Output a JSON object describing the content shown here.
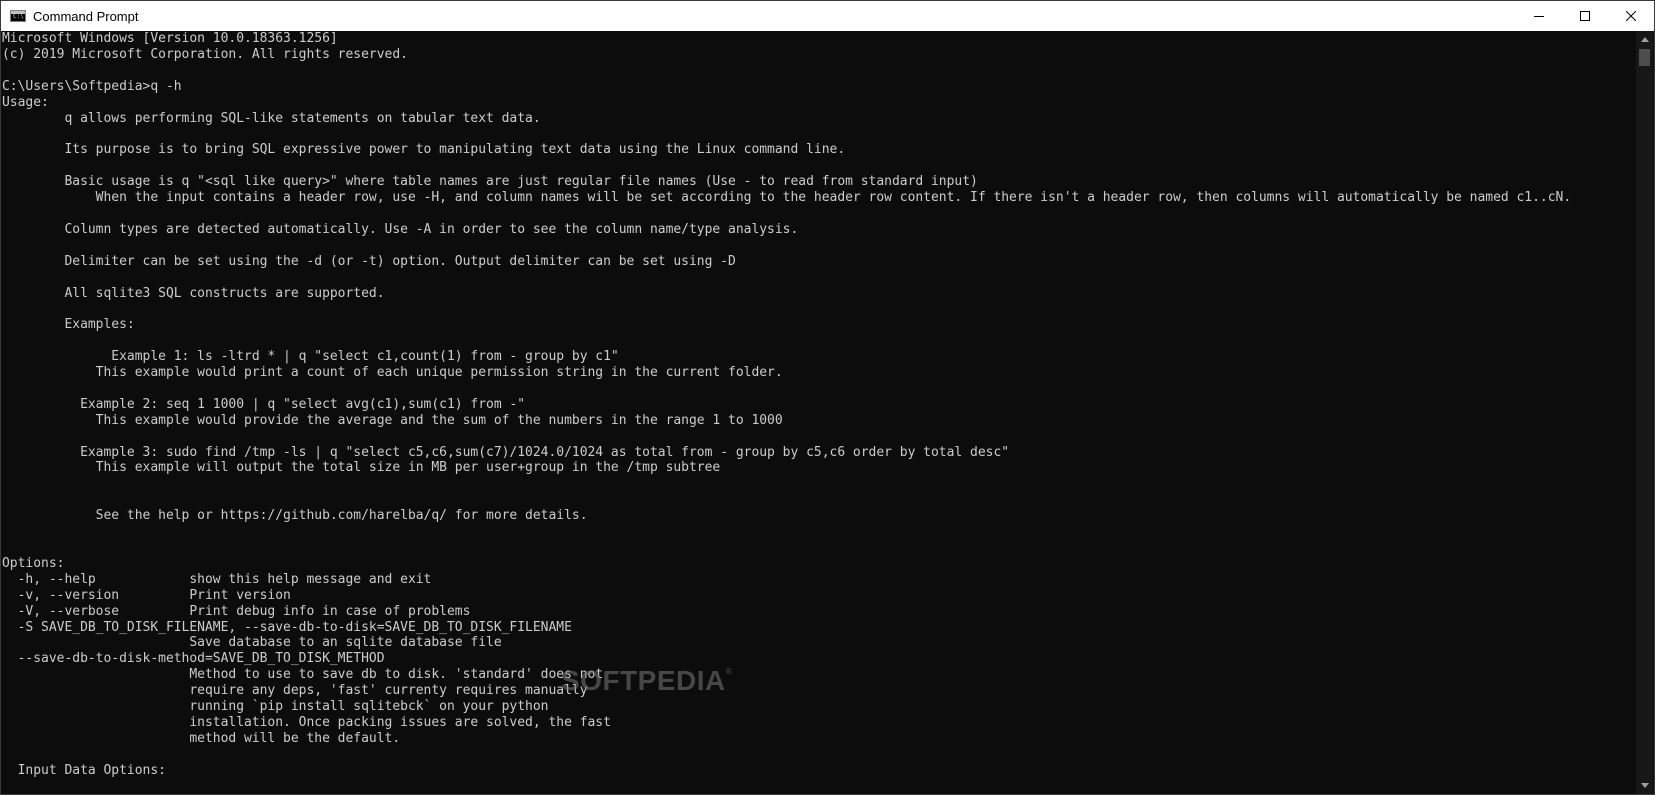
{
  "window": {
    "title": "Command Prompt",
    "icon": "console-app-icon",
    "icon_glyph": "C:\\",
    "minimize_icon": "minimize-icon",
    "maximize_icon": "maximize-icon",
    "close_icon": "close-icon"
  },
  "console": {
    "lines": [
      "Microsoft Windows [Version 10.0.18363.1256]",
      "(c) 2019 Microsoft Corporation. All rights reserved.",
      "",
      "C:\\Users\\Softpedia>q -h",
      "Usage:",
      "        q allows performing SQL-like statements on tabular text data.",
      "",
      "        Its purpose is to bring SQL expressive power to manipulating text data using the Linux command line.",
      "",
      "        Basic usage is q \"<sql like query>\" where table names are just regular file names (Use - to read from standard input)",
      "            When the input contains a header row, use -H, and column names will be set according to the header row content. If there isn't a header row, then columns will automatically be named c1..cN.",
      "",
      "        Column types are detected automatically. Use -A in order to see the column name/type analysis.",
      "",
      "        Delimiter can be set using the -d (or -t) option. Output delimiter can be set using -D",
      "",
      "        All sqlite3 SQL constructs are supported.",
      "",
      "        Examples:",
      "",
      "              Example 1: ls -ltrd * | q \"select c1,count(1) from - group by c1\"",
      "            This example would print a count of each unique permission string in the current folder.",
      "",
      "          Example 2: seq 1 1000 | q \"select avg(c1),sum(c1) from -\"",
      "            This example would provide the average and the sum of the numbers in the range 1 to 1000",
      "",
      "          Example 3: sudo find /tmp -ls | q \"select c5,c6,sum(c7)/1024.0/1024 as total from - group by c5,c6 order by total desc\"",
      "            This example will output the total size in MB per user+group in the /tmp subtree",
      "",
      "",
      "            See the help or https://github.com/harelba/q/ for more details.",
      "",
      "",
      "Options:",
      "  -h, --help            show this help message and exit",
      "  -v, --version         Print version",
      "  -V, --verbose         Print debug info in case of problems",
      "  -S SAVE_DB_TO_DISK_FILENAME, --save-db-to-disk=SAVE_DB_TO_DISK_FILENAME",
      "                        Save database to an sqlite database file",
      "  --save-db-to-disk-method=SAVE_DB_TO_DISK_METHOD",
      "                        Method to use to save db to disk. 'standard' does not",
      "                        require any deps, 'fast' currenty requires manually",
      "                        running `pip install sqlitebck` on your python",
      "                        installation. Once packing issues are solved, the fast",
      "                        method will be the default.",
      "",
      "  Input Data Options:"
    ]
  },
  "watermark": {
    "text": "SOFTPEDIA",
    "mark": "®"
  },
  "colors": {
    "background": "#0c0c0c",
    "text": "#cccccc",
    "titlebar": "#ffffff",
    "scrollbar_track": "#171717",
    "scrollbar_thumb": "#4d4d4d"
  },
  "scrollbar": {
    "up_icon": "scroll-up-arrow-icon",
    "down_icon": "scroll-down-arrow-icon"
  }
}
